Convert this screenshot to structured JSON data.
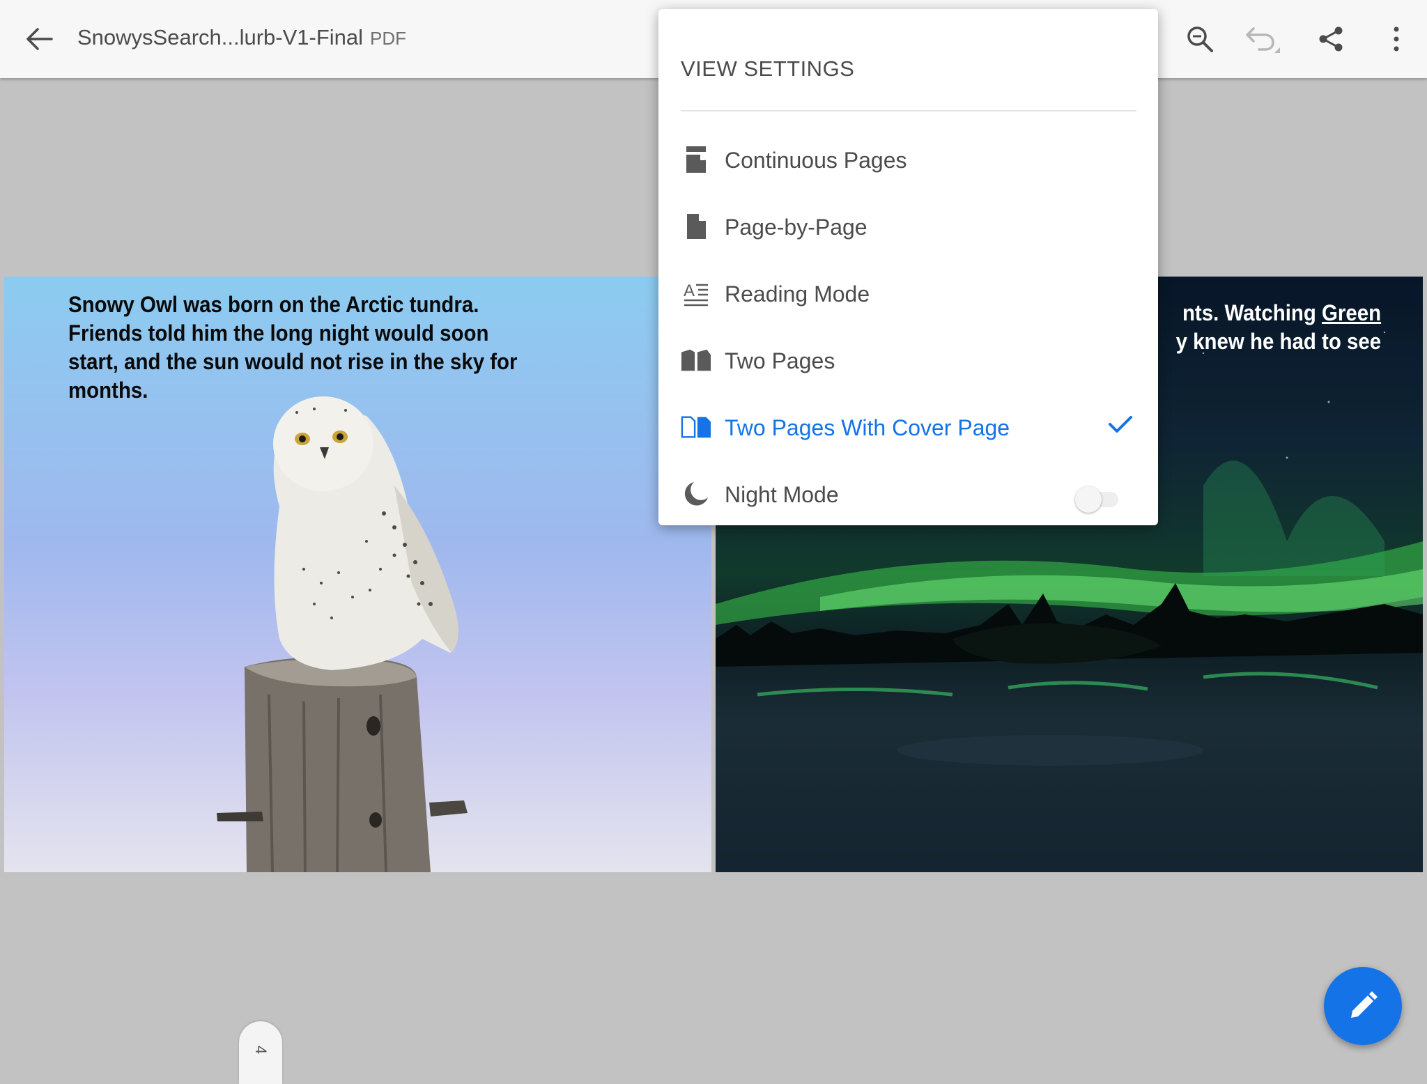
{
  "header": {
    "title": "SnowysSearch...lurb-V1-Final",
    "file_type": "PDF",
    "icons": [
      "back-arrow-icon",
      "search-icon",
      "undo-icon",
      "share-icon",
      "more-vertical-icon"
    ]
  },
  "view_settings": {
    "title": "VIEW SETTINGS",
    "options": [
      {
        "label": "Continuous Pages",
        "icon": "continuous-pages-icon",
        "selected": false
      },
      {
        "label": "Page-by-Page",
        "icon": "page-icon",
        "selected": false
      },
      {
        "label": "Reading Mode",
        "icon": "reading-mode-icon",
        "selected": false
      },
      {
        "label": "Two Pages",
        "icon": "two-pages-icon",
        "selected": false
      },
      {
        "label": "Two Pages With Cover Page",
        "icon": "two-pages-cover-icon",
        "selected": true
      },
      {
        "label": "Night Mode",
        "icon": "moon-icon",
        "toggle": false
      }
    ],
    "accent_color": "#1473e6"
  },
  "document": {
    "left_page_text": "Snowy Owl was born on the Arctic tundra. Friends told him the long night would soon start, and the sun would not rise in the sky for months.",
    "right_page_line1_prefix": "nts. Watching ",
    "right_page_line1_link": "Green",
    "right_page_line2": "y knew he had to see"
  },
  "page_indicator": "4",
  "fab": {
    "icon": "pencil-icon",
    "color": "#1473e6"
  }
}
